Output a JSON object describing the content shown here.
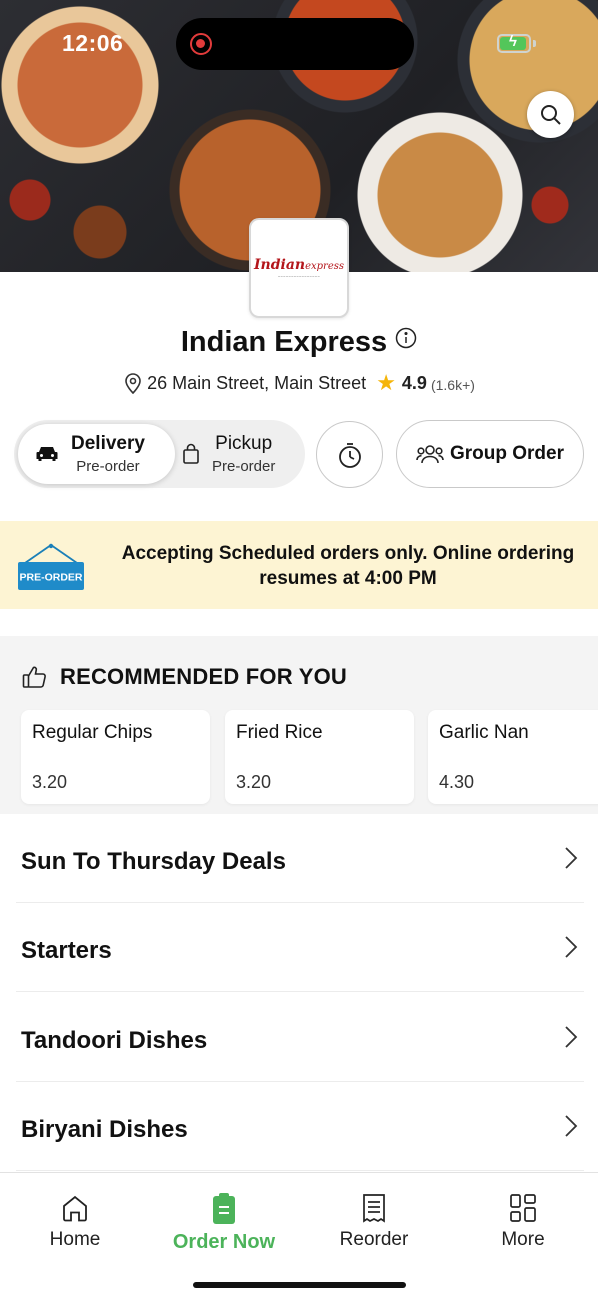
{
  "status": {
    "time": "12:06"
  },
  "restaurant": {
    "logo_text": "Indian",
    "logo_text_suffix": "express",
    "name": "Indian Express",
    "address": "26 Main Street, Main Street",
    "rating": "4.9",
    "rating_count": "(1.6k+)"
  },
  "order_mode": {
    "delivery": {
      "title": "Delivery",
      "subtitle": "Pre-order"
    },
    "pickup": {
      "title": "Pickup",
      "subtitle": "Pre-order"
    },
    "selected": "delivery"
  },
  "group_order": {
    "label": "Group Order"
  },
  "banner": {
    "badge": "PRE-ORDER",
    "text": "Accepting Scheduled orders only. Online ordering resumes at 4:00 PM"
  },
  "recommended": {
    "title": "RECOMMENDED FOR YOU",
    "items": [
      {
        "name": "Regular Chips",
        "price": "3.20"
      },
      {
        "name": "Fried Rice",
        "price": "3.20"
      },
      {
        "name": "Garlic Nan",
        "price": "4.30"
      }
    ]
  },
  "categories": [
    {
      "name": "Sun To Thursday Deals"
    },
    {
      "name": "Starters"
    },
    {
      "name": "Tandoori Dishes"
    },
    {
      "name": "Biryani Dishes"
    }
  ],
  "nav": {
    "items": [
      {
        "label": "Home",
        "icon": "home-icon"
      },
      {
        "label": "Order Now",
        "icon": "order-icon"
      },
      {
        "label": "Reorder",
        "icon": "receipt-icon"
      },
      {
        "label": "More",
        "icon": "grid-icon"
      }
    ],
    "active": "Order Now",
    "accent": "#4cb35a"
  },
  "colors": {
    "banner_bg": "#fdf4d3",
    "star": "#f5b50a",
    "accent": "#4cb35a"
  }
}
